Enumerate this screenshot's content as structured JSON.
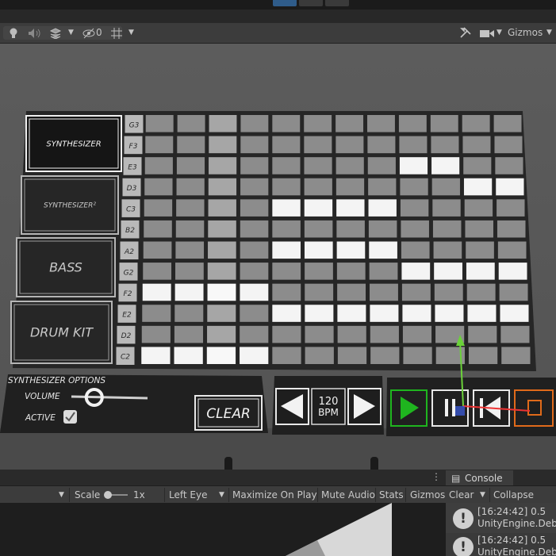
{
  "toolbar": {
    "audio_mute_label": "0",
    "gizmos_label": "Gizmos"
  },
  "synth": {
    "instruments": [
      "SYNTHESIZER",
      "SYNTHESIZER²",
      "BASS",
      "DRUM KIT"
    ],
    "selected_instrument_index": 0,
    "notes": [
      "G3",
      "F3",
      "E3",
      "D3",
      "C3",
      "B2",
      "A2",
      "G2",
      "F2",
      "E2",
      "D2",
      "C2"
    ],
    "columns": 12,
    "playhead_column": 2,
    "grid": [
      [
        0,
        0,
        0,
        0,
        0,
        0,
        0,
        0,
        0,
        0,
        0,
        0
      ],
      [
        0,
        0,
        0,
        0,
        0,
        0,
        0,
        0,
        0,
        0,
        0,
        0
      ],
      [
        0,
        0,
        0,
        0,
        0,
        0,
        0,
        0,
        1,
        1,
        0,
        0
      ],
      [
        0,
        0,
        0,
        0,
        0,
        0,
        0,
        0,
        0,
        0,
        1,
        1
      ],
      [
        0,
        0,
        0,
        0,
        1,
        1,
        1,
        1,
        0,
        0,
        0,
        0
      ],
      [
        0,
        0,
        0,
        0,
        0,
        0,
        0,
        0,
        0,
        0,
        0,
        0
      ],
      [
        0,
        0,
        0,
        0,
        1,
        1,
        1,
        1,
        0,
        0,
        0,
        0
      ],
      [
        0,
        0,
        0,
        0,
        0,
        0,
        0,
        0,
        1,
        1,
        1,
        1
      ],
      [
        1,
        1,
        1,
        1,
        0,
        0,
        0,
        0,
        0,
        0,
        0,
        0
      ],
      [
        0,
        0,
        0,
        0,
        1,
        1,
        1,
        1,
        1,
        1,
        1,
        1
      ],
      [
        0,
        0,
        0,
        0,
        0,
        0,
        0,
        0,
        0,
        0,
        0,
        0
      ],
      [
        1,
        1,
        1,
        1,
        0,
        0,
        0,
        0,
        0,
        0,
        0,
        0
      ]
    ],
    "options_title": "SYNTHESIZER OPTIONS",
    "volume_label": "VOLUME",
    "volume_value": 0.3,
    "active_label": "ACTIVE",
    "active_checked": true,
    "clear_label": "CLEAR",
    "bpm_value": "120",
    "bpm_unit": "BPM"
  },
  "gameview": {
    "scale_label": "Scale",
    "scale_value": "1x",
    "eye_value": "Left Eye",
    "maximize_label": "Maximize On Play",
    "mute_label": "Mute Audio",
    "stats_label": "Stats",
    "gizmos_label": "Gizmos"
  },
  "console": {
    "tab_label": "Console",
    "clear_label": "Clear",
    "collapse_label": "Collapse",
    "logs": [
      {
        "line1": "[16:24:42] 0.5",
        "line2": "UnityEngine.Debug"
      },
      {
        "line1": "[16:24:42] 0.5",
        "line2": "UnityEngine.Debug"
      }
    ]
  },
  "colors": {
    "panel": "#202020",
    "cell_off": "#8c8c8c",
    "cell_on": "#f4f4f4",
    "play_green": "#1fb51f",
    "scene_bg": "#585858"
  }
}
